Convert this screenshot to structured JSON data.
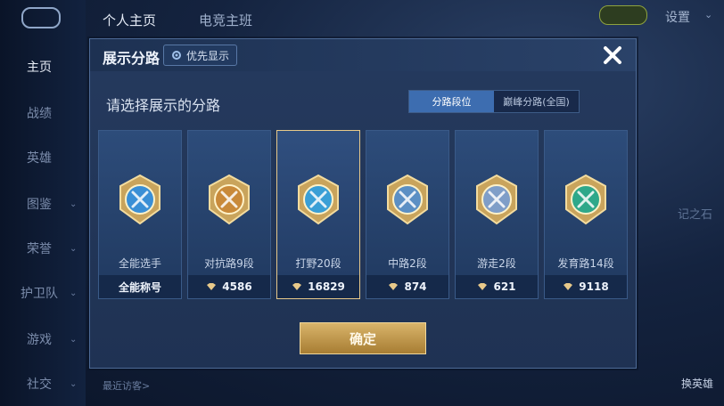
{
  "background": {
    "top_tabs": [
      "个人主页",
      "电竞主班"
    ],
    "settings_label": "设置",
    "nav": [
      {
        "label": "主页",
        "active": true
      },
      {
        "label": "战绩"
      },
      {
        "label": "英雄"
      },
      {
        "label": "图鉴",
        "chevron": true
      },
      {
        "label": "荣誉",
        "chevron": true
      },
      {
        "label": "护卫队",
        "chevron": true
      },
      {
        "label": "游戏",
        "chevron": true
      },
      {
        "label": "社交",
        "chevron": true
      }
    ],
    "recent_visitors": "最近访客>",
    "swap_hero": "换英雄",
    "side_text": "记之石"
  },
  "modal": {
    "title": "展示分路",
    "priority_button": "优先显示",
    "subtitle": "请选择展示的分路",
    "toggle": {
      "options": [
        "分路段位",
        "巅峰分路(全国)"
      ],
      "selected": "分路段位"
    },
    "confirm_label": "确定",
    "cards": [
      {
        "name": "全能选手",
        "score": "全能称号",
        "badge": "all-round-badge",
        "color": "#3a8fd6"
      },
      {
        "name": "对抗路9段",
        "score": "4586",
        "badge": "clash-lane-badge",
        "color": "#c98a3a"
      },
      {
        "name": "打野20段",
        "score": "16829",
        "badge": "jungle-badge",
        "color": "#3a9fd6",
        "selected": true
      },
      {
        "name": "中路2段",
        "score": "874",
        "badge": "mid-lane-badge",
        "color": "#5b8fc4"
      },
      {
        "name": "游走2段",
        "score": "621",
        "badge": "roam-badge",
        "color": "#7f9ec8"
      },
      {
        "name": "发育路14段",
        "score": "9118",
        "badge": "farm-lane-badge",
        "color": "#2fa88a"
      }
    ]
  },
  "colors": {
    "accent_gold": "#e8c98a",
    "toggle_selected": "#3d6db0"
  }
}
